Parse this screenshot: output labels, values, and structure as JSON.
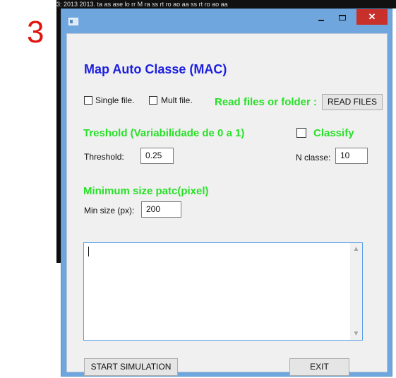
{
  "figure": {
    "number": "3"
  },
  "background": {
    "strip_text": "3: 2013     2013.  ta  as ase  lo    rr M  ra   ss  rt  ro  ao  aa  ss  rt  ro  ao  aa"
  },
  "window": {
    "title": "",
    "controls": {
      "minimize": "",
      "maximize": "",
      "close": "✕"
    }
  },
  "form": {
    "title": "Map Auto Classe (MAC)",
    "single_file_label": "Single file.",
    "mult_file_label": "Mult file.",
    "read_label": "Read files or folder :",
    "read_button": "READ FILES",
    "threshold_heading": "Treshold (Variabilidade  de 0 a 1)",
    "classify_label": "Classify",
    "threshold_label": "Threshold:",
    "threshold_value": "0.25",
    "nclasse_label": "N classe:",
    "nclasse_value": "10",
    "minsize_heading": "Minimum size patc(pixel)",
    "minsize_label": "Min size (px):",
    "minsize_value": "200",
    "output_text": "",
    "start_button": "START SIMULATION",
    "exit_button": "EXIT"
  },
  "colors": {
    "title_blue": "#1c1ee0",
    "heading_green": "#28e028",
    "figure_red": "#e0140e",
    "titlebar": "#6fa6dd",
    "close_red": "#c7302b"
  },
  "icons": [
    "app-window-icon",
    "minimize-icon",
    "maximize-icon",
    "close-icon",
    "scroll-up-arrow-icon",
    "scroll-down-arrow-icon"
  ]
}
